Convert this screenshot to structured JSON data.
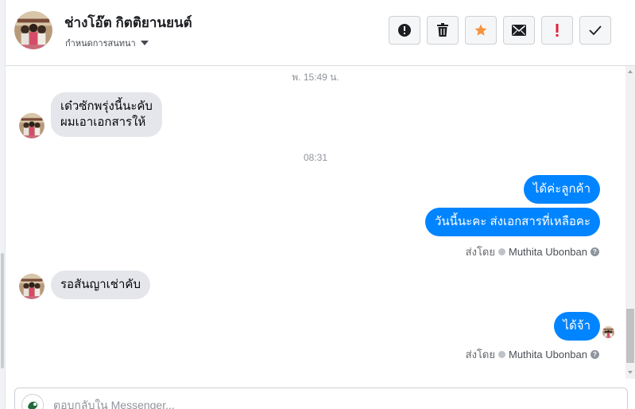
{
  "header": {
    "contact_name": "ช่างโอ๊ต กิตติยานยนต์",
    "sub_label": "กำหนดการสนทนา",
    "actions": [
      {
        "name": "spam-button",
        "icon": "alert-circle-icon"
      },
      {
        "name": "delete-button",
        "icon": "trash-icon"
      },
      {
        "name": "star-button",
        "icon": "star-icon",
        "color": "#f7923b"
      },
      {
        "name": "mark-unread-button",
        "icon": "envelope-icon"
      },
      {
        "name": "important-button",
        "icon": "exclamation-icon",
        "color": "#e41e3f"
      },
      {
        "name": "mark-done-button",
        "icon": "check-icon"
      }
    ]
  },
  "messages": {
    "ts1": "พ. 15:49 น.",
    "in1_line1": "เด๋วซักพรุ่งนี้นะคับ",
    "in1_line2": "ผมเอาเอกสารให้",
    "ts2": "08:31",
    "out1": "ได้ค่ะลูกค้า",
    "out2": "วันนี้นะคะ ส่งเอกสารที่เหลือคะ",
    "sent_by_label": "ส่งโดย",
    "sent_by_name": "Muthita Ubonban",
    "in2": "รอสันญาเช่าคับ",
    "out3": "ได้จ้า"
  },
  "composer": {
    "placeholder": "ตอบกลับใน Messenger..."
  },
  "colors": {
    "outgoing_bubble": "#0084ff",
    "incoming_bubble": "#e4e6eb",
    "star": "#f7923b",
    "important": "#e41e3f"
  }
}
